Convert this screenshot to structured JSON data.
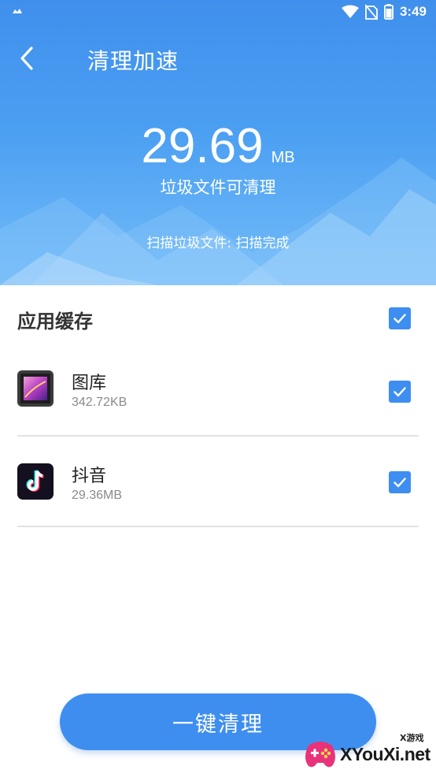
{
  "status_bar": {
    "time": "3:49",
    "icons": [
      "notification-icon",
      "wifi-icon",
      "no-sim-icon",
      "battery-icon"
    ]
  },
  "header": {
    "title": "清理加速",
    "back_icon": "chevron-left-icon"
  },
  "summary": {
    "size_value": "29.69",
    "size_unit": "MB",
    "description": "垃圾文件可清理",
    "scan_status": "扫描垃圾文件: 扫描完成"
  },
  "section": {
    "title": "应用缓存",
    "checked": true
  },
  "apps": [
    {
      "name": "图库",
      "size": "342.72KB",
      "icon": "gallery-icon",
      "checked": true
    },
    {
      "name": "抖音",
      "size": "29.36MB",
      "icon": "tiktok-icon",
      "checked": true
    }
  ],
  "actions": {
    "clean_label": "一键清理"
  },
  "watermark": {
    "small_text": "X游戏",
    "site": "XYouXi.net"
  },
  "colors": {
    "primary": "#3e8ef0",
    "checkbox": "#3d8ef0",
    "hero_top": "#3f8fec",
    "hero_bottom": "#72bbf8"
  }
}
